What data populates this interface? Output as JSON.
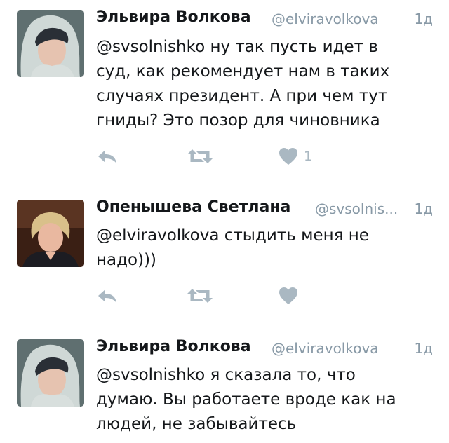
{
  "tweets": [
    {
      "name": "Эльвира Волкова",
      "handle": "@elviravolkova",
      "time": "1д",
      "lines": [
        "@svsolnishko ну так пусть идет в",
        "суд, как рекомендует нам в таких",
        "случаях президент. А при чем тут",
        "гниды? Это позор для чиновника"
      ],
      "like_count": "1"
    },
    {
      "name": "Опенышева Светлана",
      "handle": "@svsolnis...",
      "time": "1д",
      "lines": [
        "@elviravolkova стыдить меня не",
        "надо)))"
      ],
      "like_count": ""
    },
    {
      "name": "Эльвира Волкова",
      "handle": "@elviravolkova",
      "time": "1д",
      "lines": [
        "@svsolnishko я сказала то, что",
        "думаю. Вы работаете вроде как на",
        "людей, не забывайтесь"
      ]
    }
  ],
  "colors": {
    "name": "#14171a",
    "meta": "#8899a6",
    "action_icon": "#aab8c2",
    "divider": "#e1e8ed"
  },
  "icons": {
    "reply": "reply-icon",
    "retweet": "retweet-icon",
    "like": "heart-icon"
  }
}
